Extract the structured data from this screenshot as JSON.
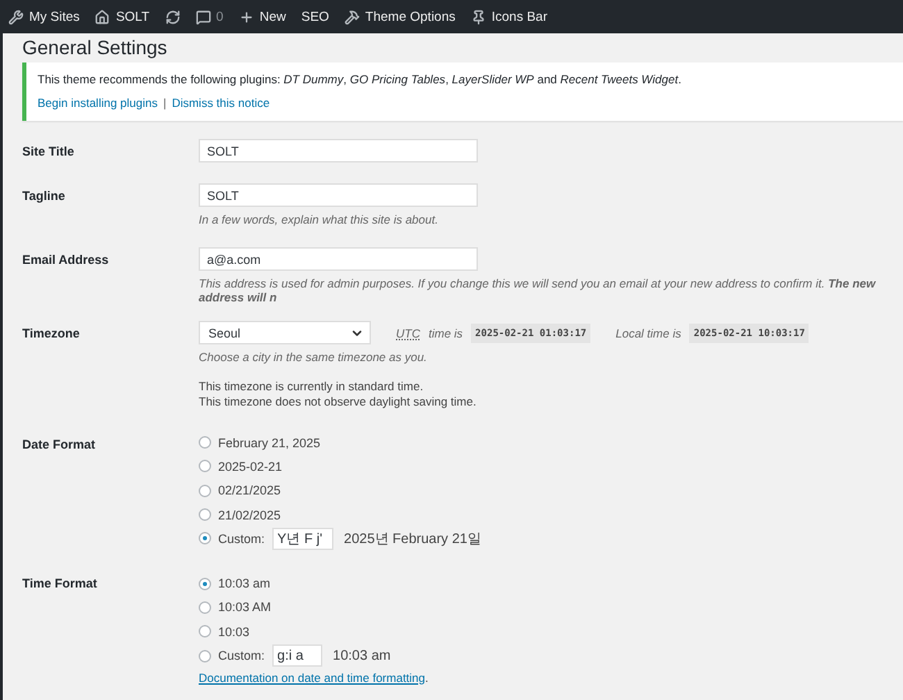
{
  "admin_bar": {
    "items": [
      {
        "kind": "sites",
        "label": "My Sites"
      },
      {
        "kind": "home",
        "label": "SOLT"
      },
      {
        "kind": "customize"
      },
      {
        "kind": "comments",
        "label": "0"
      },
      {
        "kind": "new",
        "label": "New"
      },
      {
        "kind": "plain",
        "label": "SEO"
      },
      {
        "kind": "tools",
        "label": "Theme Options"
      },
      {
        "kind": "pin",
        "label": "Icons Bar"
      }
    ]
  },
  "page_title": "General Settings",
  "notice": {
    "text": "This theme recommends the following plugins: *DT Dummy*, *GO Pricing Tables*, *LayerSlider WP* and *Recent Tweets Widget*.",
    "links": [
      "Begin installing plugins",
      "Dismiss this notice"
    ],
    "separator": "|"
  },
  "site_title": {
    "label": "Site Title",
    "value": "SOLT"
  },
  "tagline": {
    "label": "Tagline",
    "value": "SOLT",
    "description": "In a few words, explain what this site is about."
  },
  "email": {
    "label": "Email Address",
    "value": "a@a.com",
    "description": "This address is used for admin purposes. If you change this we will send you an email at your new address to confirm it. **The new address will n**"
  },
  "timezone": {
    "label": "Timezone",
    "value": "Seoul",
    "utc_abbr": "UTC",
    "utc_text": "time is",
    "utc_time": "2025-02-21 01:03:17",
    "local_text": "Local time is",
    "local_time": "2025-02-21 10:03:17",
    "description": "Choose a city in the same timezone as you.",
    "notes": [
      "This timezone is currently in standard time.",
      "This timezone does not observe daylight saving time."
    ]
  },
  "date_format": {
    "label": "Date Format",
    "options": [
      {
        "kind": "preset",
        "label": "February 21, 2025",
        "selected": false
      },
      {
        "kind": "preset",
        "label": "2025-02-21",
        "selected": false
      },
      {
        "kind": "preset",
        "label": "02/21/2025",
        "selected": false
      },
      {
        "kind": "preset",
        "label": "21/02/2025",
        "selected": false
      },
      {
        "kind": "custom",
        "label": "Custom:",
        "value": "Y년 F j'",
        "preview": "2025년 February 21일",
        "selected": true
      }
    ]
  },
  "time_format": {
    "label": "Time Format",
    "options": [
      {
        "kind": "preset",
        "label": "10:03 am",
        "selected": true
      },
      {
        "kind": "preset",
        "label": "10:03 AM",
        "selected": false
      },
      {
        "kind": "preset",
        "label": "10:03",
        "selected": false
      },
      {
        "kind": "custom",
        "label": "Custom:",
        "value": "g:i a",
        "preview": "10:03 am",
        "selected": false
      }
    ],
    "doc_link": "Documentation on date and time formatting",
    "doc_after": "."
  }
}
